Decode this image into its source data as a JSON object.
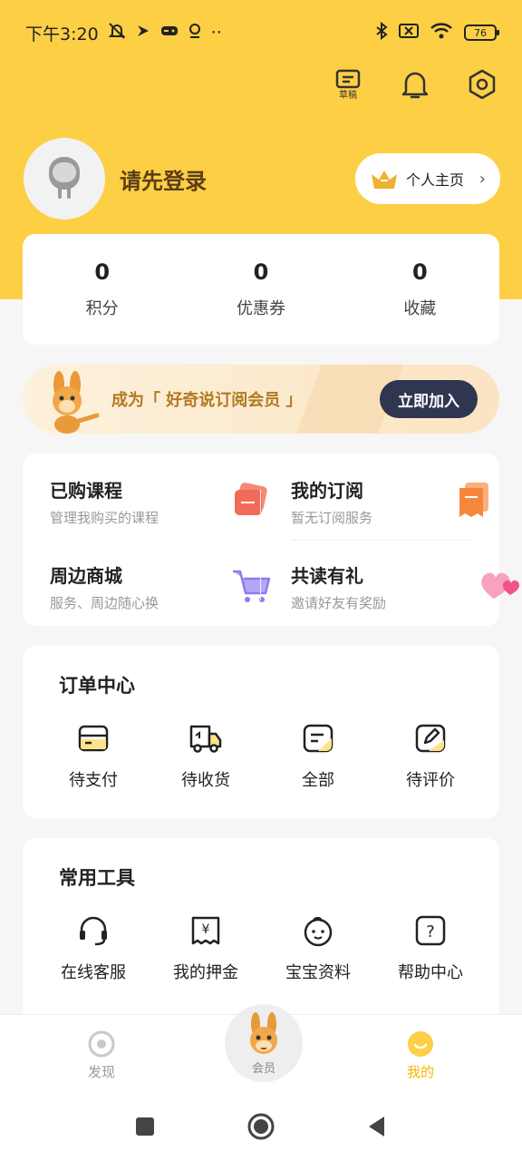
{
  "status_bar": {
    "time": "下午3:20",
    "battery": "76"
  },
  "header": {
    "draft_label": "草稿"
  },
  "profile": {
    "login_prompt": "请先登录",
    "home_button": "个人主页"
  },
  "stats": [
    {
      "value": "0",
      "label": "积分"
    },
    {
      "value": "0",
      "label": "优惠券"
    },
    {
      "value": "0",
      "label": "收藏"
    }
  ],
  "vip": {
    "text": "成为「 好奇说订阅会员 」",
    "button": "立即加入"
  },
  "services": [
    {
      "title": "已购课程",
      "subtitle": "管理我购买的课程"
    },
    {
      "title": "我的订阅",
      "subtitle": "暂无订阅服务"
    },
    {
      "title": "周边商城",
      "subtitle": "服务、周边随心换"
    },
    {
      "title": "共读有礼",
      "subtitle": "邀请好友有奖励"
    }
  ],
  "orders": {
    "title": "订单中心",
    "items": [
      {
        "label": "待支付",
        "icon": "card-icon"
      },
      {
        "label": "待收货",
        "icon": "truck-icon"
      },
      {
        "label": "全部",
        "icon": "list-icon"
      },
      {
        "label": "待评价",
        "icon": "edit-icon"
      }
    ]
  },
  "tools": {
    "title": "常用工具",
    "items": [
      {
        "label": "在线客服",
        "icon": "headset-icon"
      },
      {
        "label": "我的押金",
        "icon": "deposit-icon"
      },
      {
        "label": "宝宝资料",
        "icon": "baby-icon"
      },
      {
        "label": "帮助中心",
        "icon": "help-icon"
      }
    ]
  },
  "tabbar": {
    "discover": "发现",
    "member": "会员",
    "mine": "我的"
  },
  "colors": {
    "brand_yellow": "#fdcf45",
    "active_tab": "#f5b800",
    "vip_text": "#b27a22",
    "join_button": "#2f3650"
  }
}
